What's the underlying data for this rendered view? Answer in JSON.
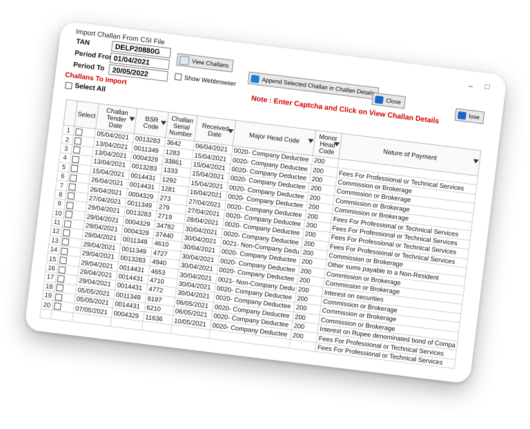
{
  "window": {
    "title": "Import Challan From CSI File",
    "minimize_glyph": "–",
    "restore_glyph": "□"
  },
  "form": {
    "tan_label": "TAN",
    "tan_value": "DELP20880G",
    "period_from_label": "Period From",
    "period_from_value": "01/04/2021",
    "period_to_label": "Period To",
    "period_to_value": "20/05/2022",
    "challans_to_import_label": "Challans To Import",
    "select_all_label": "Select All",
    "show_webbrowser_label": "Show Webbrowser"
  },
  "buttons": {
    "view_challans": "View Challans",
    "append_selected": "Append  Selected Challan in Challan Details",
    "close": "Close",
    "close2": "lose"
  },
  "note": "Note : Enter Captcha and Click on View Challan Details",
  "icons": {
    "view_challans": "document-icon",
    "append": "append-icon",
    "close": "close-icon"
  },
  "colors": {
    "note": "#d00000",
    "append_icon": "#1e7fd6",
    "close_icon": "#1a66c8"
  },
  "table": {
    "columns": [
      "",
      "Select",
      "Challan Tender Date",
      "BSR Code",
      "Challan Serial Number",
      "Received Date",
      "Major Head Code",
      "Monor Head Code",
      "Nature of Payment"
    ],
    "rows": [
      {
        "n": "1",
        "tender": "05/04/2021",
        "bsr": "0013283",
        "serial": "3642",
        "received": "06/04/2021",
        "major": "0020- Company Deductee",
        "minor": "200",
        "nature": ""
      },
      {
        "n": "2",
        "tender": "13/04/2021",
        "bsr": "0011349",
        "serial": "1283",
        "received": "15/04/2021",
        "major": "0020- Company Deductee",
        "minor": "200",
        "nature": "Fees For Professional or Technical Services"
      },
      {
        "n": "3",
        "tender": "13/04/2021",
        "bsr": "0004329",
        "serial": "33861",
        "received": "15/04/2021",
        "major": "0020- Company Deductee",
        "minor": "200",
        "nature": "Commission or Brokerage"
      },
      {
        "n": "4",
        "tender": "13/04/2021",
        "bsr": "0013283",
        "serial": "1333",
        "received": "15/04/2021",
        "major": "0020- Company Deductee",
        "minor": "200",
        "nature": "Commission or Brokerage"
      },
      {
        "n": "5",
        "tender": "15/04/2021",
        "bsr": "0014431",
        "serial": "1292",
        "received": "15/04/2021",
        "major": "0020- Company Deductee",
        "minor": "200",
        "nature": "Commission or Brokerage"
      },
      {
        "n": "6",
        "tender": "26/04/2021",
        "bsr": "0014431",
        "serial": "1281",
        "received": "16/04/2021",
        "major": "0020- Company Deductee",
        "minor": "200",
        "nature": "Commission or Brokerage"
      },
      {
        "n": "7",
        "tender": "26/04/2021",
        "bsr": "0004329",
        "serial": "273",
        "received": "27/04/2021",
        "major": "0020- Company Deductee",
        "minor": "200",
        "nature": "Fees For Professional or Technical Services"
      },
      {
        "n": "8",
        "tender": "27/04/2021",
        "bsr": "0011349",
        "serial": "279",
        "received": "27/04/2021",
        "major": "0020- Company Deductee",
        "minor": "200",
        "nature": "Fees For Professional or Technical Services"
      },
      {
        "n": "9",
        "tender": "29/04/2021",
        "bsr": "0013283",
        "serial": "2719",
        "received": "28/04/2021",
        "major": "0020- Company Deductee",
        "minor": "200",
        "nature": "Fees For Professional or Technical Services"
      },
      {
        "n": "10",
        "tender": "29/04/2021",
        "bsr": "0004329",
        "serial": "34782",
        "received": "30/04/2021",
        "major": "0020- Company Deductee",
        "minor": "200",
        "nature": "Fees For Professional or Technical Services"
      },
      {
        "n": "11",
        "tender": "29/04/2021",
        "bsr": "0004329",
        "serial": "37440",
        "received": "30/04/2021",
        "major": "0021- Non-Company Dedu",
        "minor": "200",
        "nature": "Commission or Brokerage"
      },
      {
        "n": "12",
        "tender": "29/04/2021",
        "bsr": "0011349",
        "serial": "4610",
        "received": "30/04/2021",
        "major": "0020- Company Deductee",
        "minor": "200",
        "nature": "Other sums payable to a Non-Resident"
      },
      {
        "n": "13",
        "tender": "29/04/2021",
        "bsr": "0011349",
        "serial": "4727",
        "received": "30/04/2021",
        "major": "0020- Company Deductee",
        "minor": "200",
        "nature": "Commission or Brokerage"
      },
      {
        "n": "14",
        "tender": "29/04/2021",
        "bsr": "0013283",
        "serial": "4940",
        "received": "30/04/2021",
        "major": "0020- Company Deductee",
        "minor": "200",
        "nature": "Commission or Brokerage"
      },
      {
        "n": "15",
        "tender": "29/04/2021",
        "bsr": "0014431",
        "serial": "4653",
        "received": "30/04/2021",
        "major": "0021- Non-Company Dedu",
        "minor": "200",
        "nature": "Interest on securities"
      },
      {
        "n": "16",
        "tender": "29/04/2021",
        "bsr": "0014431",
        "serial": "4710",
        "received": "30/04/2021",
        "major": "0020- Company Deductee",
        "minor": "200",
        "nature": "Commission or Brokerage"
      },
      {
        "n": "17",
        "tender": "29/04/2021",
        "bsr": "0014431",
        "serial": "4772",
        "received": "30/04/2021",
        "major": "0020- Company Deductee",
        "minor": "200",
        "nature": "Commission or Brokerage"
      },
      {
        "n": "18",
        "tender": "05/05/2021",
        "bsr": "0011349",
        "serial": "6197",
        "received": "06/05/2021",
        "major": "0020- Company Deductee",
        "minor": "200",
        "nature": "Commission or Brokerage"
      },
      {
        "n": "19",
        "tender": "05/05/2021",
        "bsr": "0014431",
        "serial": "6210",
        "received": "06/05/2021",
        "major": "0020- Company Deductee",
        "minor": "200",
        "nature": "Interest on Rupee denominated bond of Compa"
      },
      {
        "n": "20",
        "tender": "07/05/2021",
        "bsr": "0004329",
        "serial": "11636",
        "received": "10/05/2021",
        "major": "0020- Company Deductee",
        "minor": "200",
        "nature": "Fees For Professional or Technical Services"
      },
      {
        "n": "",
        "tender": "",
        "bsr": "",
        "serial": "",
        "received": "",
        "major": "",
        "minor": "",
        "nature": "Fees For Professional or Technical Services"
      }
    ]
  }
}
